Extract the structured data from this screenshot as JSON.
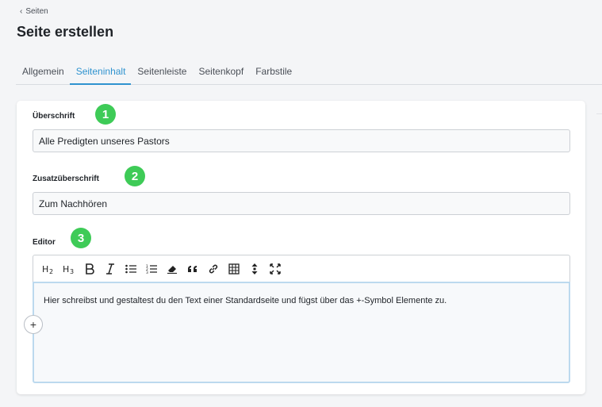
{
  "breadcrumb": {
    "back_label": "Seiten"
  },
  "page": {
    "title": "Seite erstellen"
  },
  "tabs": [
    {
      "label": "Allgemein",
      "active": false
    },
    {
      "label": "Seiteninhalt",
      "active": true
    },
    {
      "label": "Seitenleiste",
      "active": false
    },
    {
      "label": "Seitenkopf",
      "active": false
    },
    {
      "label": "Farbstile",
      "active": false
    }
  ],
  "form": {
    "heading": {
      "label": "Überschrift",
      "value": "Alle Predigten unseres Pastors",
      "badge": "1"
    },
    "subheading": {
      "label": "Zusatzüberschrift",
      "value": "Zum Nachhören",
      "badge": "2"
    },
    "editor": {
      "label": "Editor",
      "badge": "3",
      "content": "Hier schreibst und gestaltest du den Text einer Standardseite und fügst über das +-Symbol Elemente zu.",
      "toolbar": [
        "heading-2-icon",
        "heading-3-icon",
        "bold-icon",
        "italic-icon",
        "bullet-list-icon",
        "numbered-list-icon",
        "eraser-icon",
        "quote-icon",
        "link-icon",
        "table-icon",
        "line-height-icon",
        "fullscreen-icon"
      ]
    }
  },
  "colors": {
    "accent": "#2f93cf",
    "badge": "#3ecb57"
  }
}
